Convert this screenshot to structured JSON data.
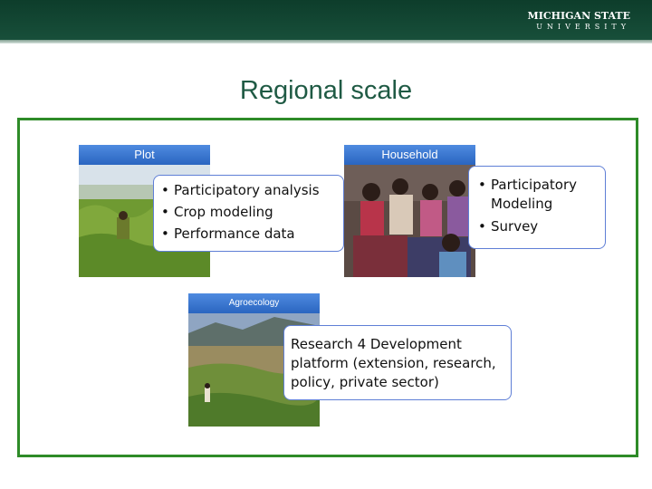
{
  "header": {
    "brand_line1": "MICHIGAN STATE",
    "brand_line2": "UNIVERSITY"
  },
  "title": "Regional scale",
  "panels": {
    "plot": {
      "label": "Plot",
      "bullets": [
        "Participatory analysis",
        "Crop modeling",
        "Performance data"
      ]
    },
    "household": {
      "label": "Household",
      "bullets": [
        "Participatory Modeling",
        "Survey"
      ]
    },
    "agroecology": {
      "label": "Agroecology",
      "text": "Research 4 Development platform (extension, research, policy, private sector)"
    }
  },
  "colors": {
    "header_green": "#0d3d2b",
    "title_green": "#1f5a44",
    "frame_green": "#2e8b28",
    "label_blue": "#3a76d0"
  }
}
